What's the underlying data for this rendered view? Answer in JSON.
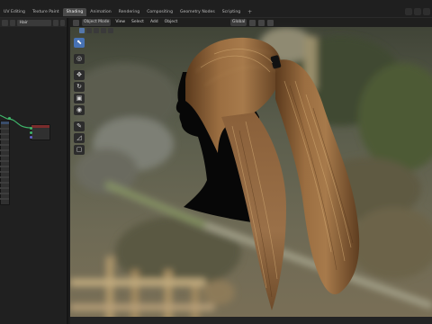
{
  "topbar": {
    "tabs": [
      {
        "label": "UV Editing",
        "active": false
      },
      {
        "label": "Texture Paint",
        "active": false
      },
      {
        "label": "Shading",
        "active": true
      },
      {
        "label": "Animation",
        "active": false
      },
      {
        "label": "Rendering",
        "active": false
      },
      {
        "label": "Compositing",
        "active": false
      },
      {
        "label": "Geometry Nodes",
        "active": false
      },
      {
        "label": "Scripting",
        "active": false
      }
    ],
    "add_tab_label": "+"
  },
  "node_editor": {
    "material_name": "Hair"
  },
  "viewport": {
    "mode_label": "Object Mode",
    "menus": [
      "View",
      "Select",
      "Add",
      "Object"
    ],
    "transform_orientation": "Global"
  },
  "toolbar": {
    "tools": [
      {
        "name": "select-tool",
        "glyph": "⬉",
        "active": true
      },
      {
        "name": "cursor-tool",
        "glyph": "◎",
        "active": false
      },
      {
        "name": "move-tool",
        "glyph": "✥",
        "active": false
      },
      {
        "name": "rotate-tool",
        "glyph": "↻",
        "active": false
      },
      {
        "name": "scale-tool",
        "glyph": "▣",
        "active": false
      },
      {
        "name": "transform-tool",
        "glyph": "◉",
        "active": false
      },
      {
        "name": "annotate-tool",
        "glyph": "✎",
        "active": false
      },
      {
        "name": "measure-tool",
        "glyph": "◿",
        "active": false
      },
      {
        "name": "add-cube-tool",
        "glyph": "▢",
        "active": false
      }
    ]
  },
  "colors": {
    "accent": "#4772b3",
    "active_tab": "#4a4a4a",
    "node_wire": "#3fb56a",
    "hair": "#8a6036"
  }
}
